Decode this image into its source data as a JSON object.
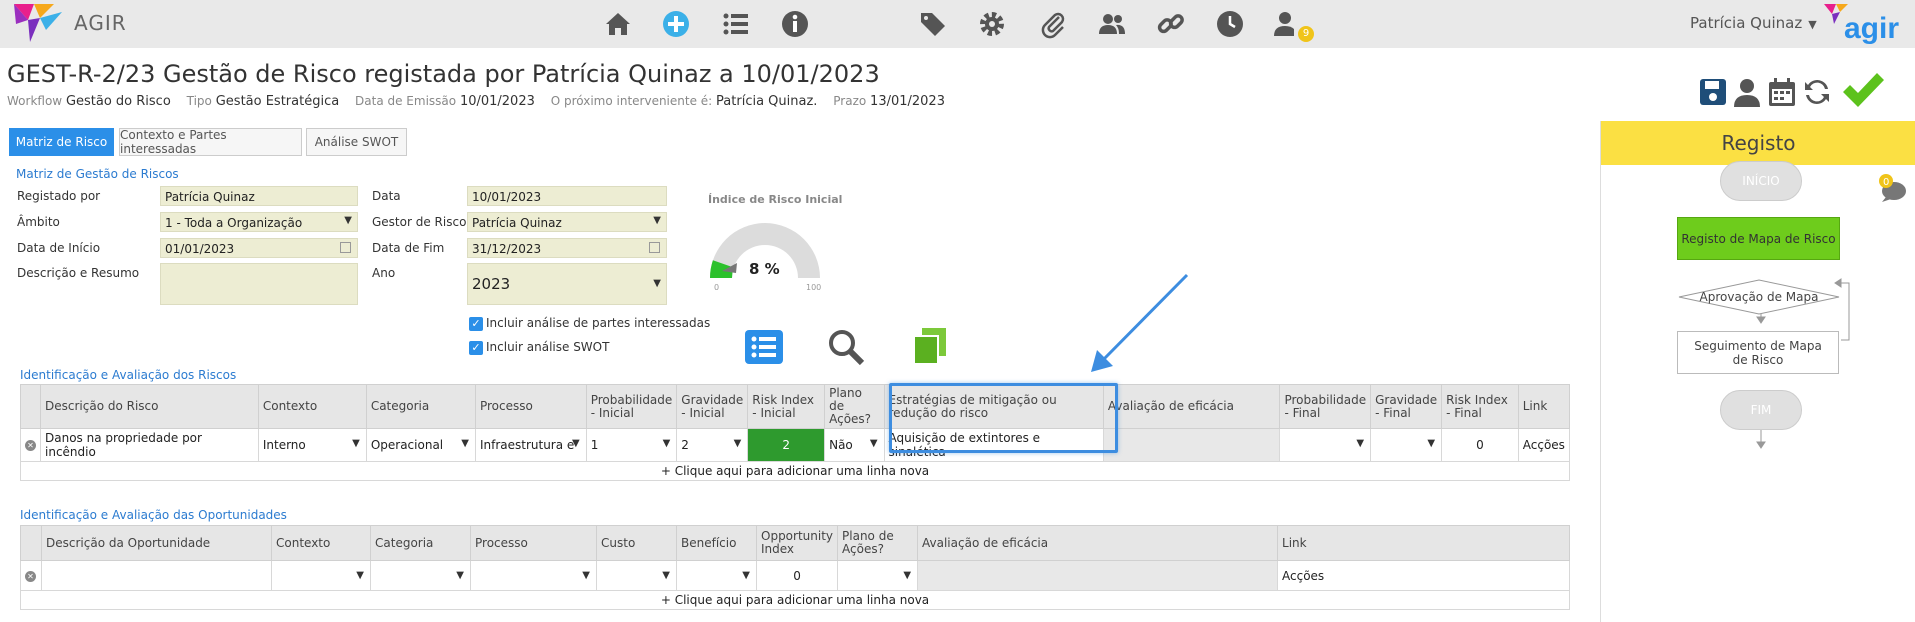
{
  "app": {
    "name": "AGIR",
    "logo_text": "agir",
    "notification_count": "9"
  },
  "toolbar_icons": [
    "home-icon",
    "add-icon",
    "list-icon",
    "info-icon",
    "tag-icon",
    "gear-icon",
    "paperclip-icon",
    "users-icon",
    "link-icon",
    "clock-icon",
    "user-clock-icon"
  ],
  "user": {
    "name": "Patrícia Quinaz"
  },
  "page": {
    "title": "GEST-R-2/23 Gestão de Risco registada por Patrícia Quinaz a 10/01/2023",
    "meta": [
      {
        "label": "Workflow",
        "value": "Gestão do Risco"
      },
      {
        "label": "Tipo",
        "value": "Gestão Estratégica"
      },
      {
        "label": "Data de Emissão",
        "value": "10/01/2023"
      },
      {
        "label": "O próximo interveniente é:",
        "value": "Patrícia Quinaz."
      },
      {
        "label": "Prazo",
        "value": "13/01/2023"
      }
    ]
  },
  "tabs": [
    {
      "label": "Matriz de Risco"
    },
    {
      "label": "Contexto e Partes interessadas"
    },
    {
      "label": "Análise SWOT"
    }
  ],
  "form": {
    "section_title": "Matriz de Gestão de Riscos",
    "registado_por": {
      "label": "Registado por",
      "value": "Patrícia Quinaz"
    },
    "ambito": {
      "label": "Âmbito",
      "value": "1 - Toda a Organização"
    },
    "data_inicio": {
      "label": "Data de Início",
      "value": "01/01/2023"
    },
    "descricao": {
      "label": "Descrição e Resumo",
      "value": ""
    },
    "data": {
      "label": "Data",
      "value": "10/01/2023"
    },
    "gestor": {
      "label": "Gestor de Risco",
      "value": "Patrícia Quinaz"
    },
    "data_fim": {
      "label": "Data de Fim",
      "value": "31/12/2023"
    },
    "ano": {
      "label": "Ano",
      "value": "2023"
    },
    "check1": "Incluir análise de partes interessadas",
    "check2": "Incluir análise SWOT"
  },
  "gauge": {
    "title": "Índice de Risco Inicial",
    "value_label": "8 %",
    "value": 8,
    "min": "0",
    "max": "100"
  },
  "risks": {
    "section_title": "Identificação e Avaliação dos Riscos",
    "headers": [
      "Descrição do Risco",
      "Contexto",
      "Categoria",
      "Processo",
      "Probabilidade - Inicial",
      "Gravidade - Inicial",
      "Risk Index - Inicial",
      "Plano de Ações?",
      "Estratégias de mitigação ou redução do risco",
      "Avaliação de eficácia",
      "Probabilidade - Final",
      "Gravidade - Final",
      "Risk Index - Final",
      "Link"
    ],
    "row": {
      "descricao": "Danos na propriedade por incêndio",
      "contexto": "Interno",
      "categoria": "Operacional",
      "processo": "Infraestrutura e",
      "prob": "1",
      "grav": "2",
      "index": "2",
      "plano": "Não",
      "estrategias": "Aquisição de extintores e sinalética",
      "avaliacao": "",
      "prob_final": "",
      "grav_final": "",
      "index_final": "0",
      "link": "Acções"
    },
    "add_row": "+ Clique aqui para adicionar uma linha nova",
    "index_color": "#2e9a2e"
  },
  "opportunities": {
    "section_title": "Identificação e Avaliação das Oportunidades",
    "headers": [
      "Descrição da Oportunidade",
      "Contexto",
      "Categoria",
      "Processo",
      "Custo",
      "Benefício",
      "Opportunity Index",
      "Plano de Ações?",
      "Avaliação de eficácia",
      "Link"
    ],
    "row": {
      "index": "0",
      "link": "Acções"
    },
    "add_row": "+ Clique aqui para adicionar uma linha nova"
  },
  "workflow": {
    "header": "Registo",
    "comment_count": "0",
    "nodes": [
      "INÍCIO",
      "Registo de Mapa de Risco",
      "Aprovação de Mapa",
      "Seguimento de Mapa de Risco",
      "FIM"
    ]
  },
  "colors": {
    "accent": "#2b8fe8",
    "panel_header": "#fbe043",
    "active_node": "#6ecc1c",
    "field_bg": "#ededd3"
  }
}
